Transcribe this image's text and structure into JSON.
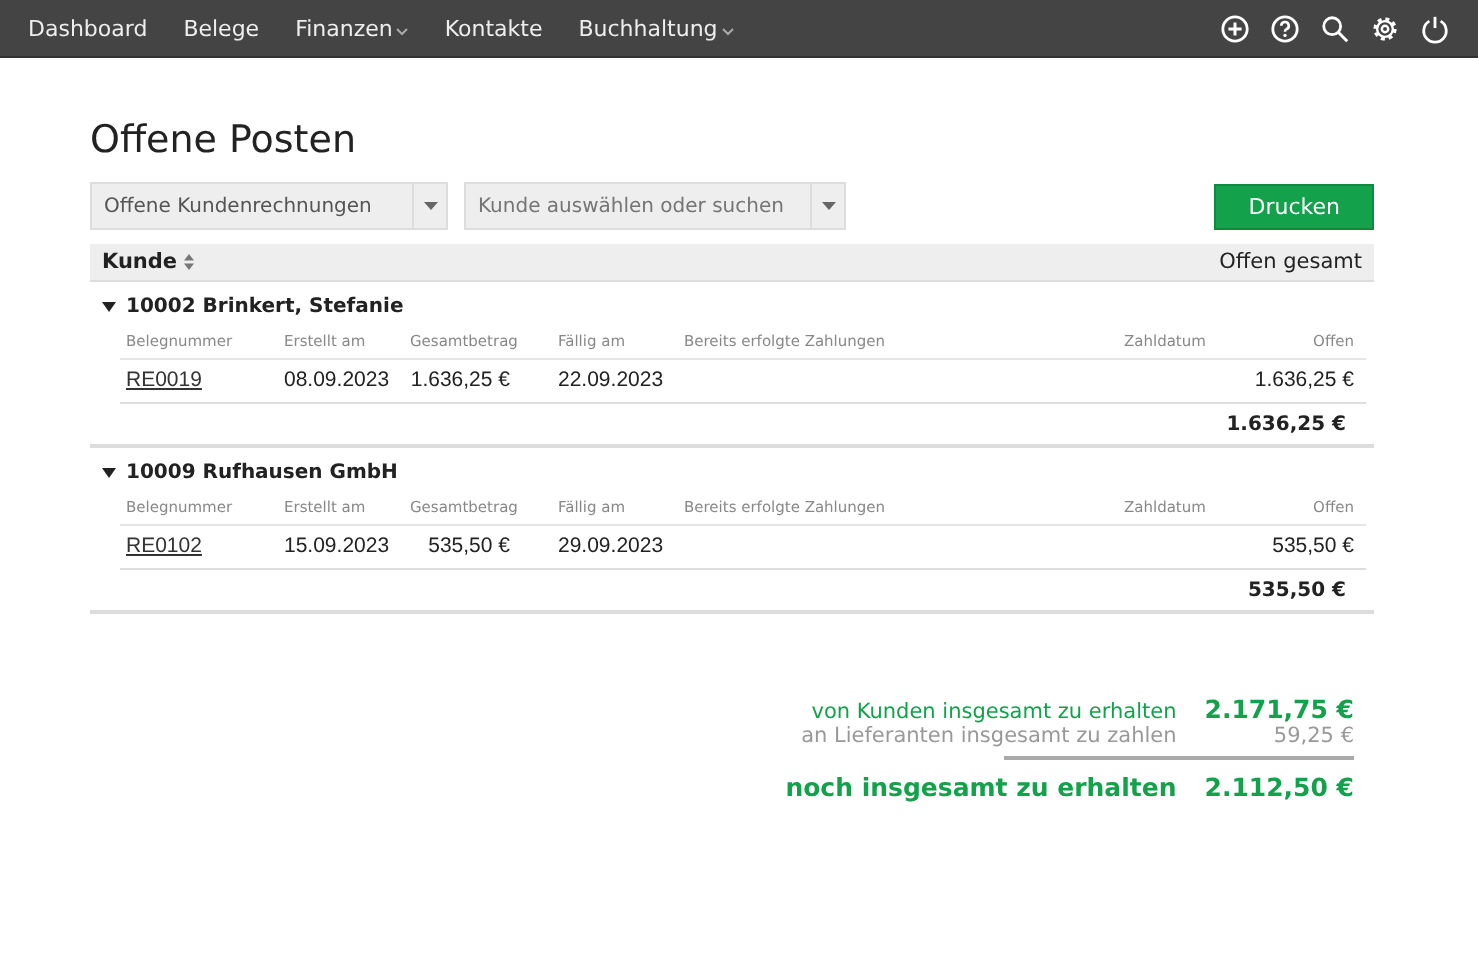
{
  "nav": {
    "items": [
      {
        "label": "Dashboard",
        "has_menu": false
      },
      {
        "label": "Belege",
        "has_menu": false
      },
      {
        "label": "Finanzen",
        "has_menu": true
      },
      {
        "label": "Kontakte",
        "has_menu": false
      },
      {
        "label": "Buchhaltung",
        "has_menu": true
      }
    ],
    "icons": [
      {
        "kind": "add"
      },
      {
        "kind": "help"
      },
      {
        "kind": "search"
      },
      {
        "kind": "settings"
      },
      {
        "kind": "power"
      }
    ]
  },
  "title": "Offene Posten",
  "filters": [
    {
      "value": "Offene Kundenrechnungen"
    },
    {
      "placeholder": "Kunde auswählen oder suchen"
    }
  ],
  "print_button": "Drucken",
  "table": {
    "columns": [
      "Kunde",
      "Offen gesamt"
    ],
    "groups": [
      {
        "customer": "10002 Brinkert, Stefanie",
        "expanded": true,
        "subcolumns": [
          "Belegnummer",
          "Erstellt am",
          "Gesamtbetrag",
          "Fällig am",
          "Bereits erfolgte Zahlungen",
          "Zahldatum",
          "Offen"
        ],
        "rows": [
          [
            "RE0019",
            "08.09.2023",
            "1.636,25 €",
            "22.09.2023",
            "",
            "",
            "1.636,25 €"
          ]
        ],
        "total": "1.636,25 €"
      },
      {
        "customer": "10009 Rufhausen GmbH",
        "expanded": true,
        "subcolumns": [
          "Belegnummer",
          "Erstellt am",
          "Gesamtbetrag",
          "Fällig am",
          "Bereits erfolgte Zahlungen",
          "Zahldatum",
          "Offen"
        ],
        "rows": [
          [
            "RE0102",
            "15.09.2023",
            "535,50 €",
            "29.09.2023",
            "",
            "",
            "535,50 €"
          ]
        ],
        "total": "535,50 €"
      }
    ]
  },
  "summary": [
    {
      "kind": "receive",
      "label": "von Kunden insgesamt zu erhalten",
      "value": "2.171,75 €"
    },
    {
      "kind": "pay",
      "label": "an Lieferanten insgesamt zu zahlen",
      "value": "59,25 €"
    },
    {
      "kind": "total",
      "label": "noch insgesamt zu erhalten",
      "value": "2.112,50 €"
    }
  ]
}
